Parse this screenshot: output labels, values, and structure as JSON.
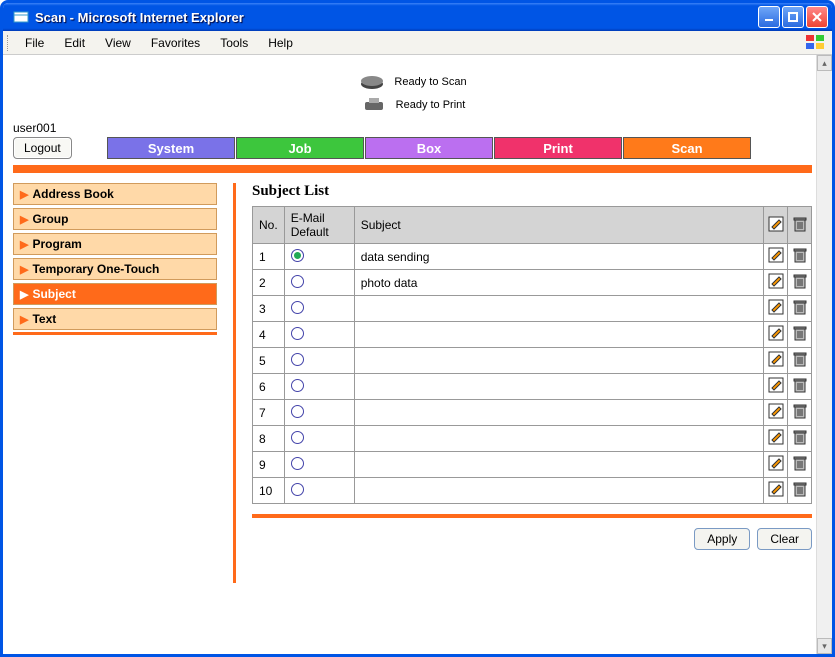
{
  "window": {
    "title": "Scan - Microsoft Internet Explorer"
  },
  "menubar": [
    "File",
    "Edit",
    "View",
    "Favorites",
    "Tools",
    "Help"
  ],
  "status": {
    "scan": "Ready to Scan",
    "print": "Ready to Print"
  },
  "user": "user001",
  "logout_label": "Logout",
  "tabs": {
    "system": "System",
    "job": "Job",
    "box": "Box",
    "print": "Print",
    "scan": "Scan"
  },
  "sidebar": {
    "items": [
      {
        "label": "Address Book",
        "active": false
      },
      {
        "label": "Group",
        "active": false
      },
      {
        "label": "Program",
        "active": false
      },
      {
        "label": "Temporary One-Touch",
        "active": false
      },
      {
        "label": "Subject",
        "active": true
      },
      {
        "label": "Text",
        "active": false
      }
    ]
  },
  "panel": {
    "title": "Subject List",
    "headers": {
      "no": "No.",
      "default": "E-Mail Default",
      "subject": "Subject"
    },
    "rows": [
      {
        "no": "1",
        "selected": true,
        "subject": "data sending"
      },
      {
        "no": "2",
        "selected": false,
        "subject": "photo data"
      },
      {
        "no": "3",
        "selected": false,
        "subject": ""
      },
      {
        "no": "4",
        "selected": false,
        "subject": ""
      },
      {
        "no": "5",
        "selected": false,
        "subject": ""
      },
      {
        "no": "6",
        "selected": false,
        "subject": ""
      },
      {
        "no": "7",
        "selected": false,
        "subject": ""
      },
      {
        "no": "8",
        "selected": false,
        "subject": ""
      },
      {
        "no": "9",
        "selected": false,
        "subject": ""
      },
      {
        "no": "10",
        "selected": false,
        "subject": ""
      }
    ],
    "apply_label": "Apply",
    "clear_label": "Clear"
  }
}
